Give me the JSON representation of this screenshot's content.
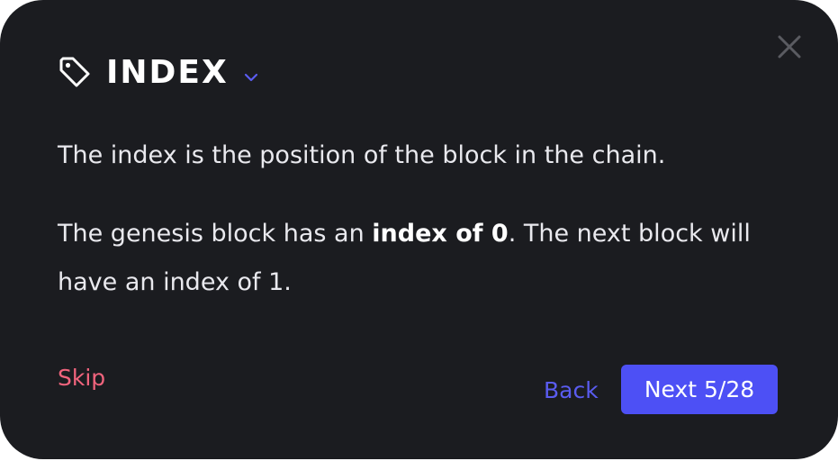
{
  "dialog": {
    "title": "INDEX",
    "title_icon": "tag-icon",
    "expand_icon": "chevron-down-icon",
    "close_icon": "close-icon",
    "paragraph1": "The index is the position of the block in the chain.",
    "paragraph2_before": "The genesis block has an ",
    "paragraph2_bold": "index of 0",
    "paragraph2_after": ". The next block will have an index of 1.",
    "skip_label": "Skip",
    "back_label": "Back",
    "next_label": "Next 5/28"
  },
  "colors": {
    "background": "#1b1c20",
    "accent": "#4d50f5",
    "back_link": "#5a5cf0",
    "skip_link": "#f1647d",
    "text": "#e9e9ee"
  }
}
